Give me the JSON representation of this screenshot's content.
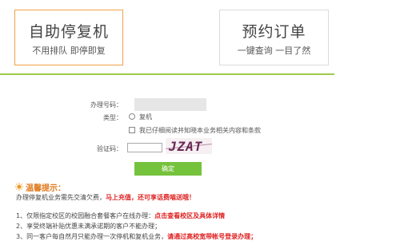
{
  "cards": {
    "self_service": {
      "title": "自助停复机",
      "subtitle": "不用排队 即停即复"
    },
    "booking": {
      "title": "预约订单",
      "subtitle": "一键查询 一目了然"
    }
  },
  "form": {
    "phone_label": "办理号码：",
    "phone_value": "",
    "type_label": "类型：",
    "type_option": "复机",
    "agree_label": "我已仔细阅读并知晓本业务相关内容和条款",
    "captcha_label": "验证码：",
    "captcha_value": "",
    "captcha_text": "JZAT",
    "submit_label": "确定"
  },
  "tips": {
    "title": "温馨提示：",
    "line1_normal": "办理停复机业务需先交清欠费，",
    "line1_red": "马上充值，还可享话费喵送哦！",
    "item1_normal": "1、仅限指定校区的校园融合套餐客户在线办理：",
    "item1_red": "点击查看校区及具体详情",
    "item2_normal": "2、享受终端补贴优惠未满承诺期的客户不能办理；",
    "item3_normal": "3、同一客户每自然月只能办理一次停机和复机业务，",
    "item3_red": "请通过高校宽带帐号登录办理；"
  },
  "colors": {
    "accent_orange": "#f2a14a",
    "divider_green": "#9fcb4a",
    "button_green": "#75c23c",
    "warning_red": "#e02020"
  }
}
